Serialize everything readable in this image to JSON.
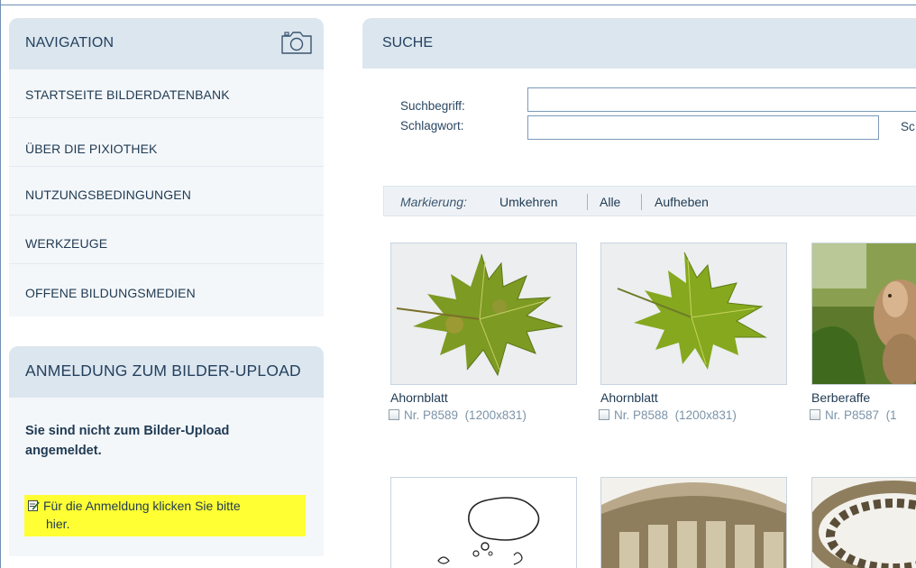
{
  "navigation": {
    "title": "NAVIGATION",
    "items": [
      {
        "label": "STARTSEITE BILDERDATENBANK"
      },
      {
        "label": "ÜBER DIE PIXIOTHEK"
      },
      {
        "label": "NUTZUNGSBEDINGUNGEN"
      },
      {
        "label": "WERKZEUGE"
      },
      {
        "label": "OFFENE BILDUNGSMEDIEN"
      }
    ]
  },
  "login": {
    "title": "ANMELDUNG ZUM BILDER-UPLOAD",
    "message": "Sie sind nicht zum Bilder-Upload angemeldet.",
    "link_line1": "Für die Anmeldung klicken Sie bitte",
    "link_line2": "hier.",
    "highlight_color": "#ffff33"
  },
  "search": {
    "title": "SUCHE",
    "term_label": "Suchbegriff:",
    "term_value": "",
    "keyword_label": "Schlagwort:",
    "keyword_value": "",
    "cut_label": "Sc"
  },
  "marking": {
    "label": "Markierung:",
    "invert": "Umkehren",
    "all": "Alle",
    "clear": "Aufheben"
  },
  "results": [
    {
      "title": "Ahornblatt",
      "number": "Nr. P8589",
      "size": "(1200x831)"
    },
    {
      "title": "Ahornblatt",
      "number": "Nr. P8588",
      "size": "(1200x831)"
    },
    {
      "title": "Berberaffe",
      "number": "Nr. P8587",
      "size": "(1"
    }
  ],
  "colors": {
    "panel_header": "#dce6ef",
    "panel_body": "#f4f7fa",
    "text": "#1f3a52"
  }
}
